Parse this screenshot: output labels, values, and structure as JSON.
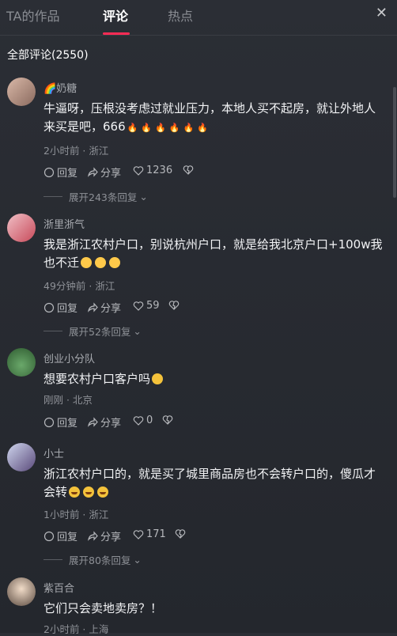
{
  "tabs": [
    "TA的作品",
    "评论",
    "热点"
  ],
  "close_icon": "close-icon",
  "comments_count_label": "全部评论(2550)",
  "actions": {
    "reply": "回复",
    "share": "分享"
  },
  "comments": [
    {
      "user": "🌈奶糖",
      "text": "牛逼呀，压根没考虑过就业压力，本地人买不起房，就让外地人来买是吧，666",
      "emojis": [
        "fire",
        "fire",
        "fire",
        "fire",
        "fire",
        "fire"
      ],
      "meta": "2小时前 · 浙江",
      "likes": "1236",
      "expand": "展开243条回复"
    },
    {
      "user": "浙里浙气",
      "text": "我是浙江农村户口，别说杭州户口，就是给我北京户口+100w我也不迁",
      "emojis": [
        "blush",
        "blush",
        "blush"
      ],
      "meta": "49分钟前 · 浙江",
      "likes": "59",
      "expand": "展开52条回复"
    },
    {
      "user": "创业小分队",
      "text": "想要农村户口客户吗",
      "emojis": [
        "smile"
      ],
      "meta": "刚刚 · 北京",
      "likes": "0",
      "expand": ""
    },
    {
      "user": "小士",
      "text": "浙江农村户口的，就是买了城里商品房也不会转户口的，傻瓜才会转",
      "emojis": [
        "laugh",
        "laugh",
        "laugh"
      ],
      "meta": "1小时前 · 浙江",
      "likes": "171",
      "expand": "展开80条回复"
    },
    {
      "user": "紫百合",
      "text": "它们只会卖地卖房？！",
      "emojis": [],
      "meta": "2小时前 · 上海",
      "likes": "",
      "expand": ""
    }
  ],
  "colors": {
    "accent": "#fe2c55",
    "background": "#2b2e35"
  }
}
